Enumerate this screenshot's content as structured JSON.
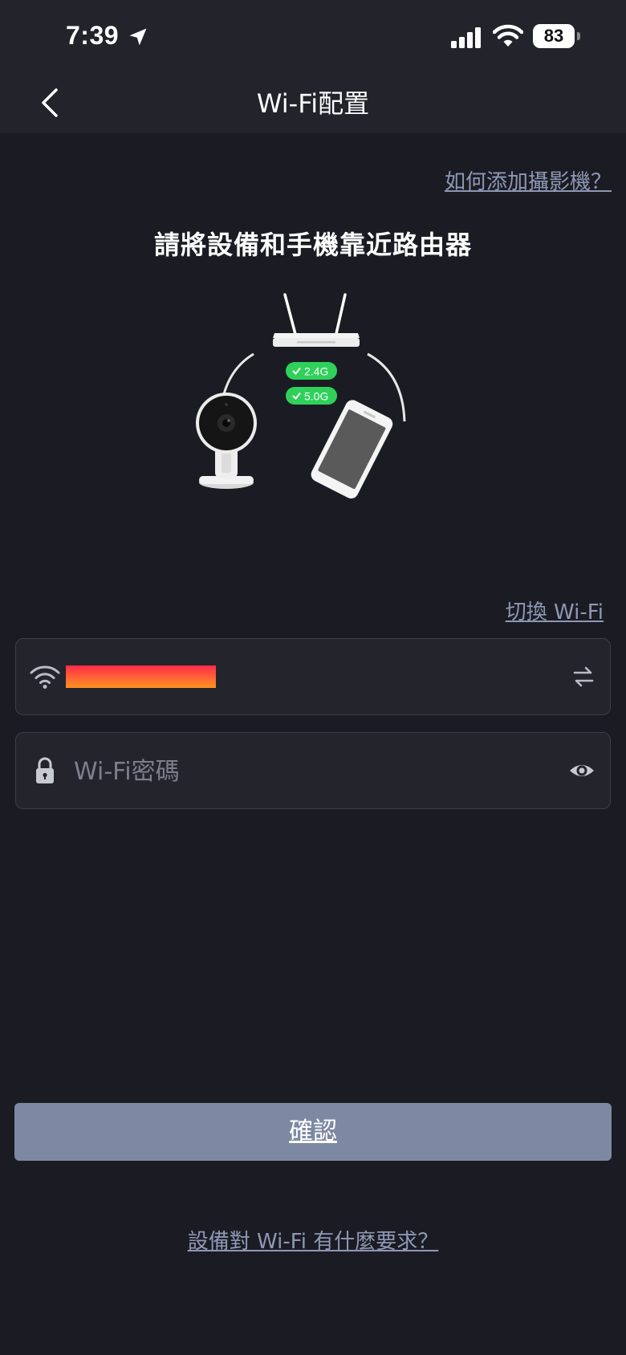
{
  "status_bar": {
    "time": "7:39",
    "battery_level": "83",
    "icons": [
      "location-arrow-icon",
      "cellular-signal-icon",
      "wifi-icon",
      "battery-icon"
    ]
  },
  "nav": {
    "title": "Wi-Fi配置",
    "back_icon": "chevron-left-icon"
  },
  "help_link": "如何添加攝影機？",
  "headline": "請將設備和手機靠近路由器",
  "illustration": {
    "band_labels": [
      "2.4G",
      "5.0G"
    ],
    "badge_color": "#2fd15a",
    "icons": [
      "router-icon",
      "camera-icon",
      "phone-icon",
      "check-icon"
    ]
  },
  "switch_wifi_link": "切換 Wi-Fi",
  "ssid_field": {
    "icon": "wifi-icon",
    "action_icon": "swap-arrows-icon",
    "redacted": true
  },
  "password_field": {
    "placeholder": "Wi-Fi密碼",
    "value": "",
    "icon": "lock-icon",
    "action_icon": "eye-icon"
  },
  "confirm_button": "確認",
  "requirements_link": "設備對 Wi-Fi 有什麼要求？",
  "colors": {
    "background": "#1b1c23",
    "header": "#22232b",
    "link": "#8e97b5",
    "button": "#7d88a3",
    "field_bg": "#23242c"
  }
}
